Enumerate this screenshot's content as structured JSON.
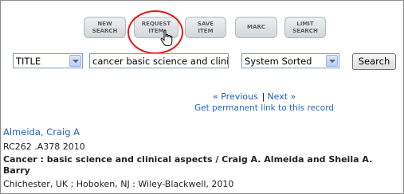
{
  "toolbar": {
    "new_search": [
      "NEW",
      "SEARCH"
    ],
    "request_item": [
      "REQUEST",
      "ITEM"
    ],
    "save_item": [
      "SAVE",
      "ITEM"
    ],
    "marc": [
      "MARC"
    ],
    "limit_search": [
      "LIMIT",
      "SEARCH"
    ]
  },
  "search": {
    "field_selected": "TITLE",
    "query_value": "cancer basic science and clinic",
    "sort_selected": "System Sorted",
    "button_label": "Search"
  },
  "navigation": {
    "previous": "« Previous",
    "separator": "|",
    "next": "Next »",
    "permalink": "Get permanent link to this record"
  },
  "record": {
    "author": "Almeida, Craig A",
    "call_number": "RC262 .A378 2010",
    "title": "Cancer : basic science and clinical aspects / Craig A. Almeida and Sheila A. Barry",
    "publication": "Chichester, UK ; Hoboken, NJ : Wiley-Blackwell, 2010"
  },
  "colors": {
    "highlight_circle": "#e31b1b",
    "link": "#1a5fb4"
  }
}
